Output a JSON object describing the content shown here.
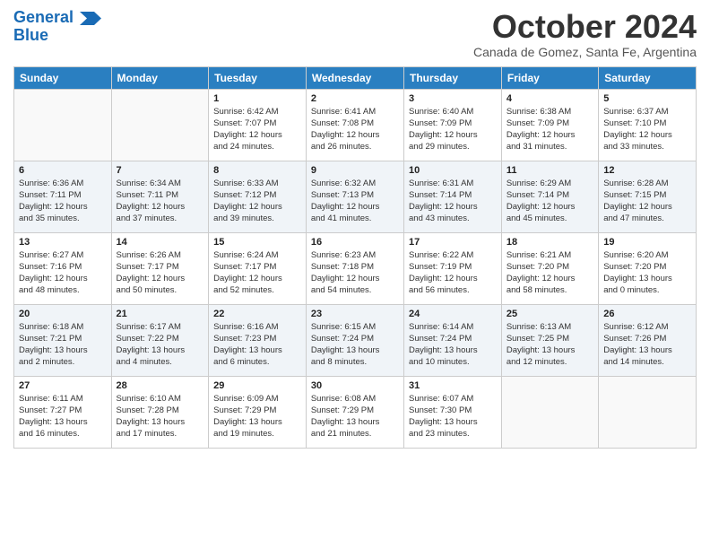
{
  "logo": {
    "line1": "General",
    "line2": "Blue",
    "arrow_color": "#1a6bb5"
  },
  "title": "October 2024",
  "subtitle": "Canada de Gomez, Santa Fe, Argentina",
  "days_of_week": [
    "Sunday",
    "Monday",
    "Tuesday",
    "Wednesday",
    "Thursday",
    "Friday",
    "Saturday"
  ],
  "weeks": [
    [
      {
        "day": "",
        "detail": ""
      },
      {
        "day": "",
        "detail": ""
      },
      {
        "day": "1",
        "detail": "Sunrise: 6:42 AM\nSunset: 7:07 PM\nDaylight: 12 hours\nand 24 minutes."
      },
      {
        "day": "2",
        "detail": "Sunrise: 6:41 AM\nSunset: 7:08 PM\nDaylight: 12 hours\nand 26 minutes."
      },
      {
        "day": "3",
        "detail": "Sunrise: 6:40 AM\nSunset: 7:09 PM\nDaylight: 12 hours\nand 29 minutes."
      },
      {
        "day": "4",
        "detail": "Sunrise: 6:38 AM\nSunset: 7:09 PM\nDaylight: 12 hours\nand 31 minutes."
      },
      {
        "day": "5",
        "detail": "Sunrise: 6:37 AM\nSunset: 7:10 PM\nDaylight: 12 hours\nand 33 minutes."
      }
    ],
    [
      {
        "day": "6",
        "detail": "Sunrise: 6:36 AM\nSunset: 7:11 PM\nDaylight: 12 hours\nand 35 minutes."
      },
      {
        "day": "7",
        "detail": "Sunrise: 6:34 AM\nSunset: 7:11 PM\nDaylight: 12 hours\nand 37 minutes."
      },
      {
        "day": "8",
        "detail": "Sunrise: 6:33 AM\nSunset: 7:12 PM\nDaylight: 12 hours\nand 39 minutes."
      },
      {
        "day": "9",
        "detail": "Sunrise: 6:32 AM\nSunset: 7:13 PM\nDaylight: 12 hours\nand 41 minutes."
      },
      {
        "day": "10",
        "detail": "Sunrise: 6:31 AM\nSunset: 7:14 PM\nDaylight: 12 hours\nand 43 minutes."
      },
      {
        "day": "11",
        "detail": "Sunrise: 6:29 AM\nSunset: 7:14 PM\nDaylight: 12 hours\nand 45 minutes."
      },
      {
        "day": "12",
        "detail": "Sunrise: 6:28 AM\nSunset: 7:15 PM\nDaylight: 12 hours\nand 47 minutes."
      }
    ],
    [
      {
        "day": "13",
        "detail": "Sunrise: 6:27 AM\nSunset: 7:16 PM\nDaylight: 12 hours\nand 48 minutes."
      },
      {
        "day": "14",
        "detail": "Sunrise: 6:26 AM\nSunset: 7:17 PM\nDaylight: 12 hours\nand 50 minutes."
      },
      {
        "day": "15",
        "detail": "Sunrise: 6:24 AM\nSunset: 7:17 PM\nDaylight: 12 hours\nand 52 minutes."
      },
      {
        "day": "16",
        "detail": "Sunrise: 6:23 AM\nSunset: 7:18 PM\nDaylight: 12 hours\nand 54 minutes."
      },
      {
        "day": "17",
        "detail": "Sunrise: 6:22 AM\nSunset: 7:19 PM\nDaylight: 12 hours\nand 56 minutes."
      },
      {
        "day": "18",
        "detail": "Sunrise: 6:21 AM\nSunset: 7:20 PM\nDaylight: 12 hours\nand 58 minutes."
      },
      {
        "day": "19",
        "detail": "Sunrise: 6:20 AM\nSunset: 7:20 PM\nDaylight: 13 hours\nand 0 minutes."
      }
    ],
    [
      {
        "day": "20",
        "detail": "Sunrise: 6:18 AM\nSunset: 7:21 PM\nDaylight: 13 hours\nand 2 minutes."
      },
      {
        "day": "21",
        "detail": "Sunrise: 6:17 AM\nSunset: 7:22 PM\nDaylight: 13 hours\nand 4 minutes."
      },
      {
        "day": "22",
        "detail": "Sunrise: 6:16 AM\nSunset: 7:23 PM\nDaylight: 13 hours\nand 6 minutes."
      },
      {
        "day": "23",
        "detail": "Sunrise: 6:15 AM\nSunset: 7:24 PM\nDaylight: 13 hours\nand 8 minutes."
      },
      {
        "day": "24",
        "detail": "Sunrise: 6:14 AM\nSunset: 7:24 PM\nDaylight: 13 hours\nand 10 minutes."
      },
      {
        "day": "25",
        "detail": "Sunrise: 6:13 AM\nSunset: 7:25 PM\nDaylight: 13 hours\nand 12 minutes."
      },
      {
        "day": "26",
        "detail": "Sunrise: 6:12 AM\nSunset: 7:26 PM\nDaylight: 13 hours\nand 14 minutes."
      }
    ],
    [
      {
        "day": "27",
        "detail": "Sunrise: 6:11 AM\nSunset: 7:27 PM\nDaylight: 13 hours\nand 16 minutes."
      },
      {
        "day": "28",
        "detail": "Sunrise: 6:10 AM\nSunset: 7:28 PM\nDaylight: 13 hours\nand 17 minutes."
      },
      {
        "day": "29",
        "detail": "Sunrise: 6:09 AM\nSunset: 7:29 PM\nDaylight: 13 hours\nand 19 minutes."
      },
      {
        "day": "30",
        "detail": "Sunrise: 6:08 AM\nSunset: 7:29 PM\nDaylight: 13 hours\nand 21 minutes."
      },
      {
        "day": "31",
        "detail": "Sunrise: 6:07 AM\nSunset: 7:30 PM\nDaylight: 13 hours\nand 23 minutes."
      },
      {
        "day": "",
        "detail": ""
      },
      {
        "day": "",
        "detail": ""
      }
    ]
  ]
}
